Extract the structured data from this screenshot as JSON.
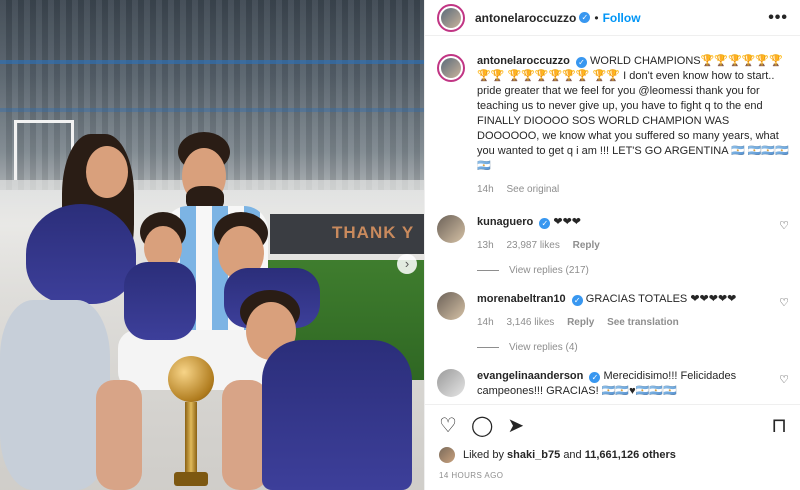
{
  "header": {
    "username": "antonelaroccuzzo",
    "verified": "✓",
    "separator": "•",
    "follow_label": "Follow",
    "more_label": "•••"
  },
  "photo": {
    "banner_text": "THANK Y",
    "next_label": "›"
  },
  "caption": {
    "username": "antonelaroccuzzo",
    "text": "WORLD CHAMPIONS🏆🏆🏆🏆🏆🏆🏆🏆 🏆🏆🏆🏆🏆🏆 🏆🏆 I don't even know how to start.. pride greater that we feel for you @leomessi thank you for teaching us to never give up, you have to fight q to the end FINALLY DIOOOO SOS WORLD CHAMPION WAS DOOOOOO, we know what you suffered so many years, what you wanted to get q i am !!! LET'S GO ARGENTINA 🇦🇷 🇦🇷🇦🇷🇦🇷🇦🇷",
    "time": "14h",
    "see_original": "See original"
  },
  "comments": [
    {
      "username": "kunaguero",
      "text": "❤❤❤",
      "time": "13h",
      "likes": "23,987 likes",
      "reply": "Reply",
      "translation": "",
      "view_replies": "View replies (217)"
    },
    {
      "username": "morenabeltran10",
      "text": "GRACIAS TOTALES ❤❤❤❤❤",
      "time": "14h",
      "likes": "3,146 likes",
      "reply": "Reply",
      "translation": "See translation",
      "view_replies": "View replies (4)"
    },
    {
      "username": "evangelinaanderson",
      "text": "Merecidisimo!!! Felicidades campeones!!! GRACIAS! 🇦🇷🇦🇷♥🇦🇷🇦🇷🇦🇷",
      "time": "",
      "likes": "",
      "reply": "",
      "translation": "",
      "view_replies": ""
    }
  ],
  "actions": {
    "like_icon": "heart-outline",
    "comment_icon": "speech-bubble",
    "share_icon": "paper-plane",
    "bookmark_icon": "bookmark-outline"
  },
  "likes": {
    "liked_by_prefix": "Liked by",
    "liked_by_user": "shaki_b75",
    "and": "and",
    "others": "11,661,126 others"
  },
  "timestamp": "14 HOURS AGO"
}
